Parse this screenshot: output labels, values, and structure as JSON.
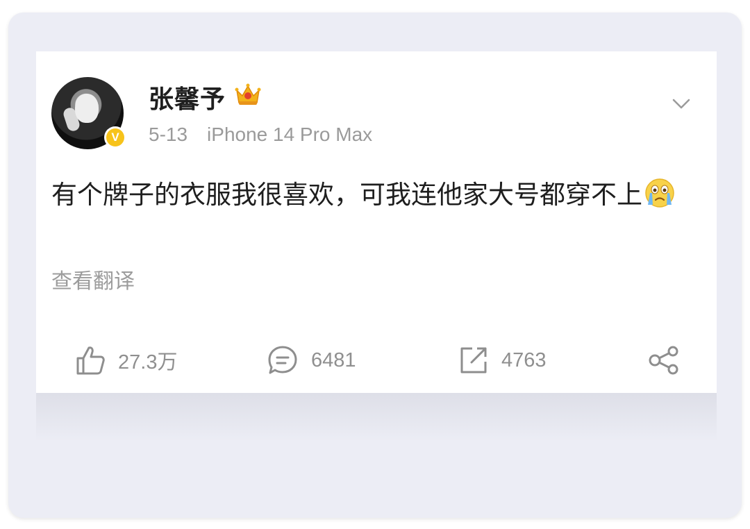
{
  "post": {
    "author": "张馨予",
    "date": "5-13",
    "device": "iPhone 14 Pro Max",
    "verified_badge": "V",
    "content": "有个牌子的衣服我很喜欢，可我连他家大号都穿不上",
    "translate_label": "查看翻译"
  },
  "actions": {
    "like_count": "27.3万",
    "comment_count": "6481",
    "repost_count": "4763"
  },
  "icons": {
    "crown": "crown-icon",
    "more": "chevron-down-icon",
    "cry_emoji": "crying-face-icon",
    "like": "thumbs-up-icon",
    "comment": "comment-icon",
    "repost": "repost-icon",
    "share": "share-icon"
  },
  "colors": {
    "background": "#ecedf5",
    "card": "#ffffff",
    "muted_text": "#9a9a9a",
    "verified": "#f7c31b"
  }
}
